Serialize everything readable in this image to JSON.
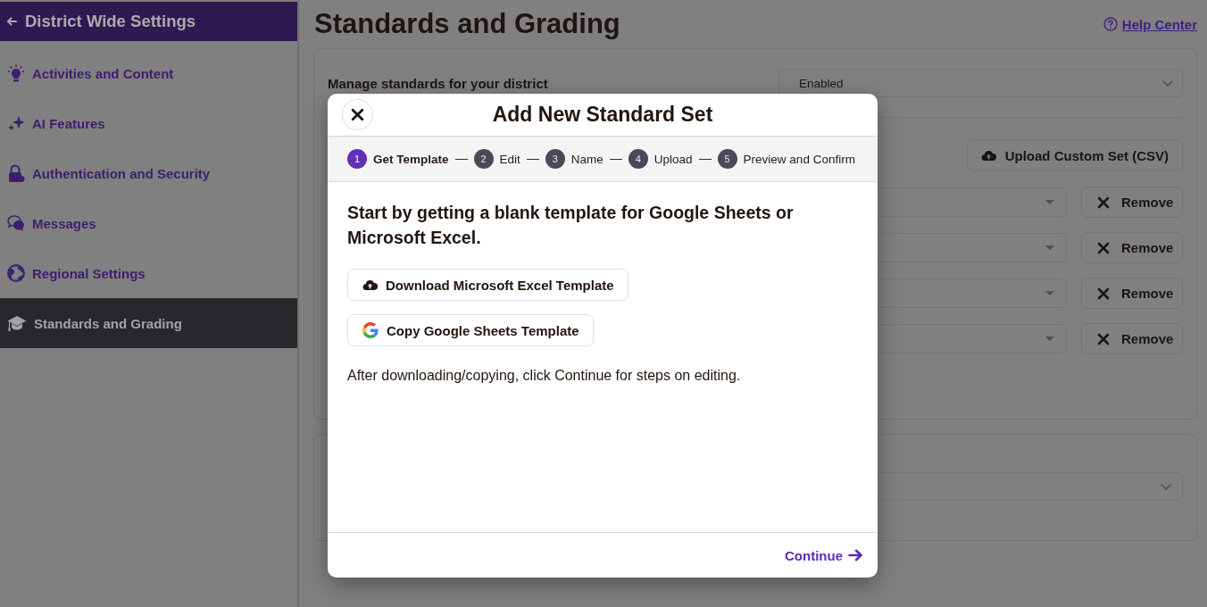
{
  "sidebar": {
    "title": "District Wide Settings",
    "items": [
      {
        "label": "Activities and Content",
        "selected": false
      },
      {
        "label": "AI Features",
        "selected": false
      },
      {
        "label": "Authentication and Security",
        "selected": false
      },
      {
        "label": "Messages",
        "selected": false
      },
      {
        "label": "Regional Settings",
        "selected": false
      },
      {
        "label": "Standards and Grading",
        "selected": true
      }
    ]
  },
  "main": {
    "title": "Standards and Grading",
    "help_link": "Help Center",
    "standards_panel": {
      "label": "Manage standards for your district",
      "select_value": "Enabled",
      "upload_button": "Upload Custom Set (CSV)",
      "standard_sets": [
        {
          "remove_button": "Remove"
        },
        {
          "remove_button": "Remove"
        },
        {
          "remove_button": "Remove"
        },
        {
          "remove_button": "Remove"
        }
      ]
    }
  },
  "modal": {
    "title": "Add New Standard Set",
    "steps": [
      {
        "number": "1",
        "label": "Get Template",
        "selected": true
      },
      {
        "number": "2",
        "label": "Edit",
        "selected": false
      },
      {
        "number": "3",
        "label": "Name",
        "selected": false
      },
      {
        "number": "4",
        "label": "Upload",
        "selected": false
      },
      {
        "number": "5",
        "label": "Preview and Confirm",
        "selected": false
      }
    ],
    "heading": "Start by getting a blank template for Google Sheets or Microsoft Excel.",
    "buttons": [
      {
        "kind": "download",
        "label": "Download Microsoft Excel Template"
      },
      {
        "kind": "google",
        "label": "Copy Google Sheets Template"
      }
    ],
    "note": "After downloading/copying, click Continue for steps on editing.",
    "continue_button": "Continue"
  }
}
